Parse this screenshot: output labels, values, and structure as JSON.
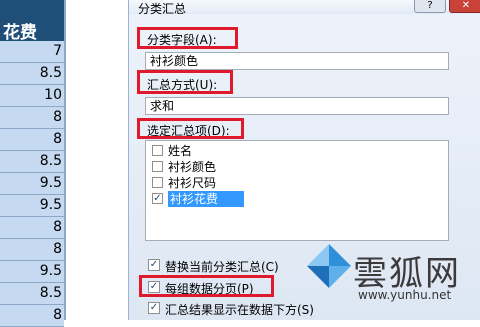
{
  "sheet": {
    "header": "花费",
    "values": [
      "7",
      "8.5",
      "10",
      "8",
      "8",
      "8.5",
      "9.5",
      "9.5",
      "8",
      "8",
      "9.5",
      "8.5",
      "8"
    ]
  },
  "dialog": {
    "title": "分类汇总",
    "help": "?",
    "close": "✕",
    "group_field_label": "分类字段(A):",
    "group_field_value": "衬衫颜色",
    "function_label": "汇总方式(U):",
    "function_value": "求和",
    "items_label": "选定汇总项(D):",
    "items": [
      {
        "label": "姓名",
        "checked": false
      },
      {
        "label": "衬衫颜色",
        "checked": false
      },
      {
        "label": "衬衫尺码",
        "checked": false
      },
      {
        "label": "衬衫花费",
        "checked": true
      }
    ],
    "options": [
      {
        "label": "替换当前分类汇总(C)",
        "checked": true
      },
      {
        "label": "每组数据分页(P)",
        "checked": true
      },
      {
        "label": "汇总结果显示在数据下方(S)",
        "checked": true
      }
    ]
  },
  "watermark": {
    "text": "雲狐网",
    "url": "www.yunhu.net"
  },
  "colors": {
    "highlight_box": "#e0192d",
    "header_fill": "#1f4e79",
    "cell_fill": "#c5d9f1",
    "selection": "#3399ff"
  }
}
